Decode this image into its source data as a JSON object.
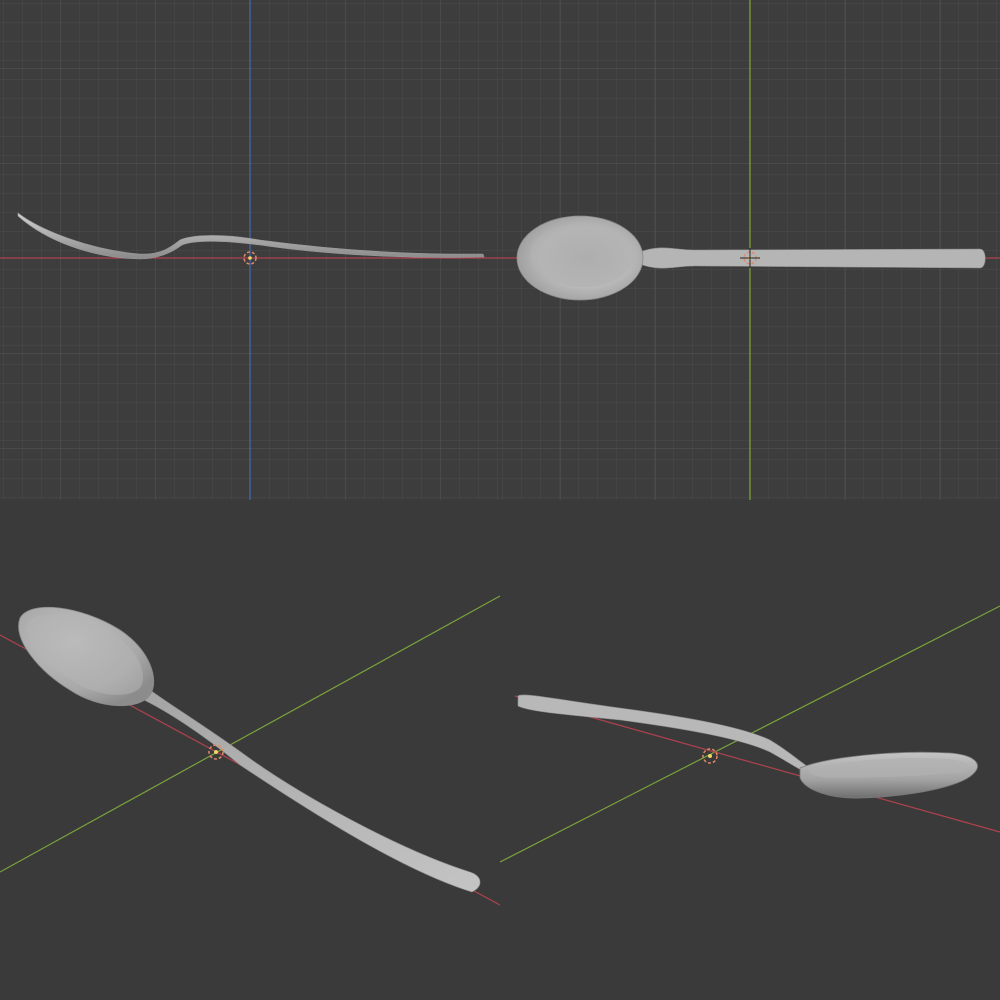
{
  "viewports": [
    {
      "id": "front",
      "view": "orthographic-side",
      "grid": true,
      "axes": [
        "x",
        "z"
      ],
      "gizmo": "origin-marker-icon",
      "object": "spoon-profile"
    },
    {
      "id": "top",
      "view": "orthographic-top",
      "grid": true,
      "axes": [
        "x",
        "y"
      ],
      "gizmo": "origin-marker-icon",
      "object": "spoon-top"
    },
    {
      "id": "persp-a",
      "view": "perspective",
      "grid": false,
      "axes": [
        "x",
        "y"
      ],
      "gizmo": "origin-marker-icon",
      "object": "spoon-perspective-bowl-up"
    },
    {
      "id": "persp-b",
      "view": "perspective",
      "grid": false,
      "axes": [
        "x",
        "y"
      ],
      "gizmo": "origin-marker-icon",
      "object": "spoon-perspective-side"
    }
  ],
  "colors": {
    "background": "#3d3d3d",
    "grid_minor": "#4a4a4a",
    "grid_major": "#545454",
    "axis_x": "#b0424f",
    "axis_y": "#7ba33a",
    "axis_z": "#3f6fb0",
    "spoon_light": "#c9c9c9",
    "spoon_mid": "#a9a9a9",
    "spoon_dark": "#7d7d7d",
    "origin_ring": "#e08a6a",
    "origin_dot": "#f4d36a"
  }
}
